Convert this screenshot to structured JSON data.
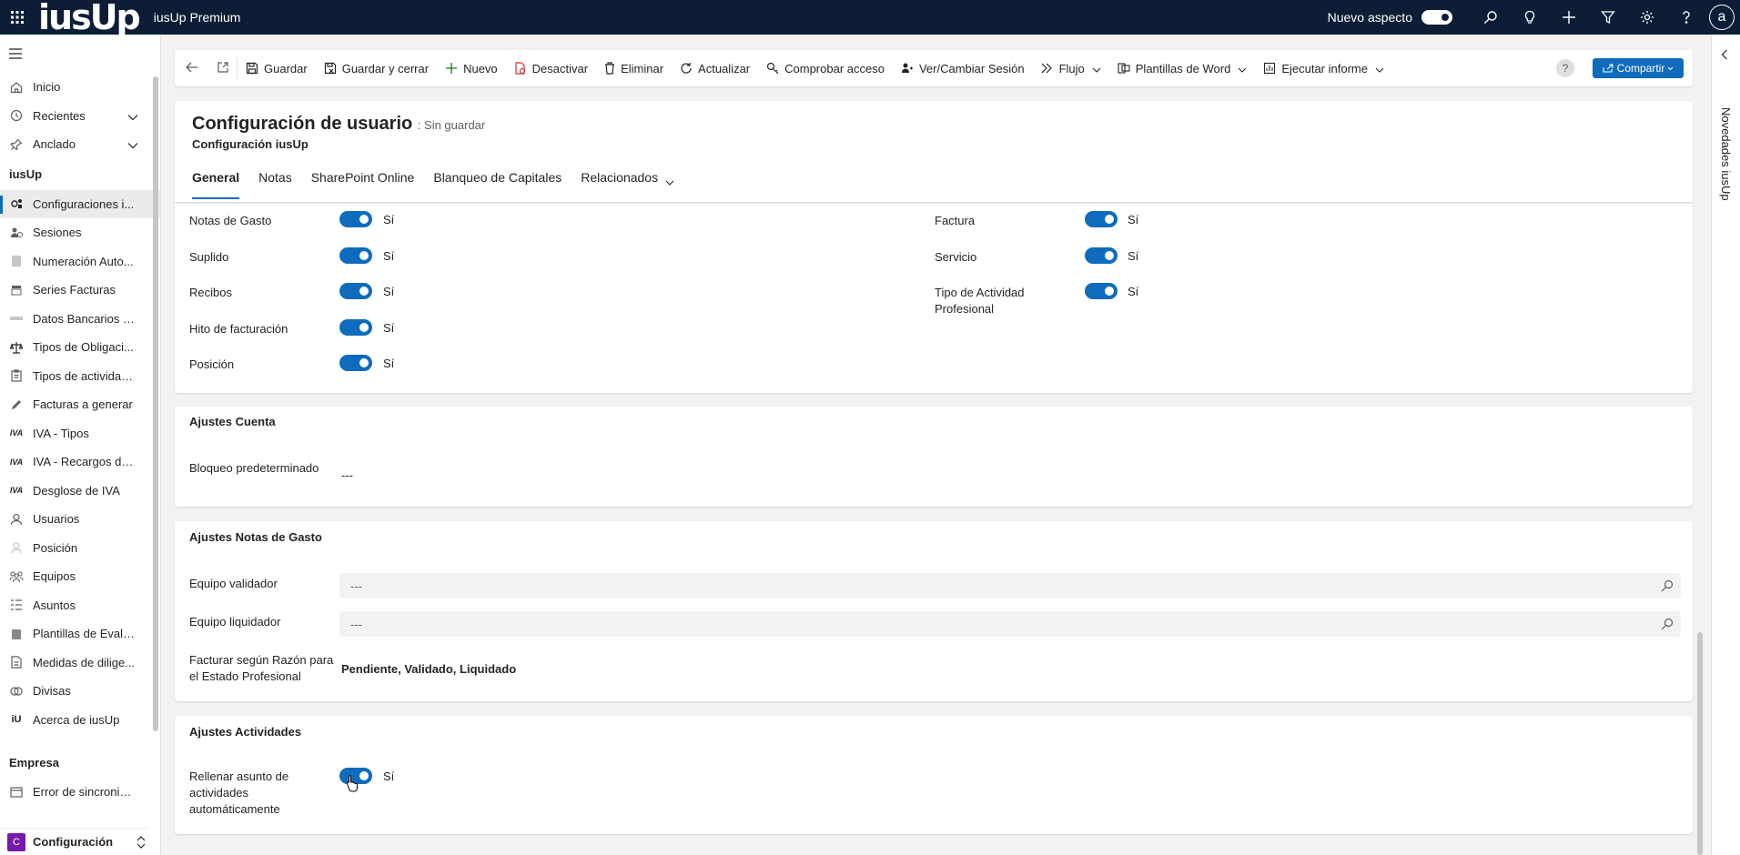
{
  "topbar": {
    "app_name": "iusUp Premium",
    "logo_text": "iusUp",
    "new_look_label": "Nuevo aspecto",
    "user_initial": "a",
    "icons": [
      "search-icon",
      "lightbulb-icon",
      "plus-icon",
      "filter-icon",
      "gear-icon",
      "help-icon"
    ]
  },
  "sidebar": {
    "items_top": [
      {
        "label": "Inicio",
        "icon": "home-icon"
      },
      {
        "label": "Recientes",
        "icon": "clock-icon"
      },
      {
        "label": "Anclado",
        "icon": "pin-icon"
      }
    ],
    "group_label": "iusUp",
    "items": [
      {
        "label": "Configuraciones i...",
        "icon": "settings-users-icon"
      },
      {
        "label": "Sesiones",
        "icon": "session-icon"
      },
      {
        "label": "Numeración Auto...",
        "icon": "numbering-icon"
      },
      {
        "label": "Series Facturas",
        "icon": "invoice-series-icon"
      },
      {
        "label": "Datos Bancarios d...",
        "icon": "bank-icon"
      },
      {
        "label": "Tipos de Obligaci...",
        "icon": "scales-icon"
      },
      {
        "label": "Tipos de actividad...",
        "icon": "clipboard-icon"
      },
      {
        "label": "Facturas a generar",
        "icon": "invoice-edit-icon"
      },
      {
        "label": "IVA - Tipos",
        "icon": "iva-icon"
      },
      {
        "label": "IVA - Recargos de ...",
        "icon": "iva-icon"
      },
      {
        "label": "Desglose de IVA",
        "icon": "iva-icon"
      },
      {
        "label": "Usuarios",
        "icon": "user-icon"
      },
      {
        "label": "Posición",
        "icon": "position-icon"
      },
      {
        "label": "Equipos",
        "icon": "team-icon"
      },
      {
        "label": "Asuntos",
        "icon": "list-icon"
      },
      {
        "label": "Plantillas de Evalu...",
        "icon": "template-icon"
      },
      {
        "label": "Medidas de dilige...",
        "icon": "document-icon"
      },
      {
        "label": "Divisas",
        "icon": "currency-icon"
      },
      {
        "label": "Acerca de iusUp",
        "icon": "iusup-icon"
      }
    ],
    "group2_label": "Empresa",
    "items2": [
      {
        "label": "Error de sincroniz...",
        "icon": "sync-error-icon"
      }
    ],
    "area": {
      "badge": "C",
      "label": "Configuración"
    }
  },
  "commands": [
    {
      "label": "Guardar",
      "icon": "save-icon"
    },
    {
      "label": "Guardar y cerrar",
      "icon": "save-close-icon"
    },
    {
      "label": "Nuevo",
      "icon": "plus-icon"
    },
    {
      "label": "Desactivar",
      "icon": "deactivate-icon"
    },
    {
      "label": "Eliminar",
      "icon": "trash-icon"
    },
    {
      "label": "Actualizar",
      "icon": "refresh-icon"
    },
    {
      "label": "Comprobar acceso",
      "icon": "key-icon"
    },
    {
      "label": "Ver/Cambiar Sesión",
      "icon": "session-switch-icon"
    },
    {
      "label": "Flujo",
      "icon": "flow-icon"
    },
    {
      "label": "Plantillas de Word",
      "icon": "word-template-icon"
    },
    {
      "label": "Ejecutar informe",
      "icon": "report-icon"
    }
  ],
  "help_label": "?",
  "share_label": "Compartir",
  "record": {
    "title": "Configuración de usuario",
    "status": ": Sin guardar",
    "subtitle": "Configuración iusUp"
  },
  "tabs": [
    "General",
    "Notas",
    "SharePoint Online",
    "Blanqueo de Capitales",
    "Relacionados"
  ],
  "toggles_left": [
    {
      "label": "Notas de Gasto",
      "value": "Sí"
    },
    {
      "label": "Suplido",
      "value": "Sí"
    },
    {
      "label": "Recibos",
      "value": "Sí"
    },
    {
      "label": "Hito de facturación",
      "value": "Sí"
    },
    {
      "label": "Posición",
      "value": "Sí"
    }
  ],
  "toggles_right": [
    {
      "label": "Factura",
      "value": "Sí"
    },
    {
      "label": "Servicio",
      "value": "Sí"
    },
    {
      "label": "Tipo de Actividad Profesional",
      "value": "Sí"
    }
  ],
  "ajustes_cuenta": {
    "title": "Ajustes Cuenta",
    "field_label": "Bloqueo predeterminado",
    "field_value": "---"
  },
  "ajustes_gasto": {
    "title": "Ajustes Notas de Gasto",
    "equipo_validador_label": "Equipo validador",
    "equipo_validador_value": "---",
    "equipo_liquidador_label": "Equipo liquidador",
    "equipo_liquidador_value": "---",
    "facturar_label": "Facturar según Razón para el Estado Profesional",
    "facturar_value": "Pendiente, Validado, Liquidado"
  },
  "ajustes_actividades": {
    "title": "Ajustes Actividades",
    "field_label": "Rellenar asunto de actividades automáticamente",
    "field_value": "Sí"
  },
  "right_rail": {
    "label": "Novedades iusUp"
  }
}
